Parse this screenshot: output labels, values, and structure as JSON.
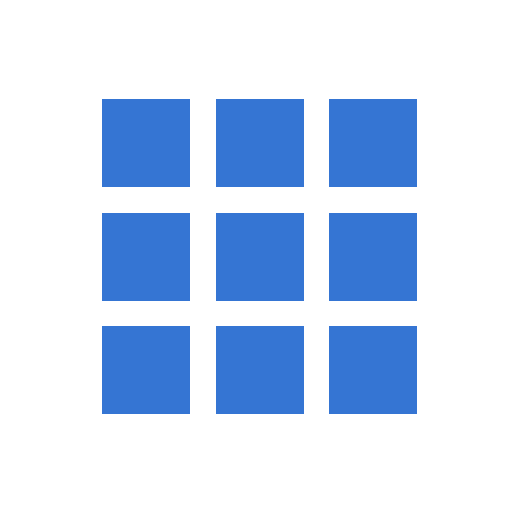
{
  "icon": {
    "name": "app-grid-icon",
    "rows": 3,
    "columns": 3,
    "color": "#3575d3",
    "background": "#ffffff"
  }
}
